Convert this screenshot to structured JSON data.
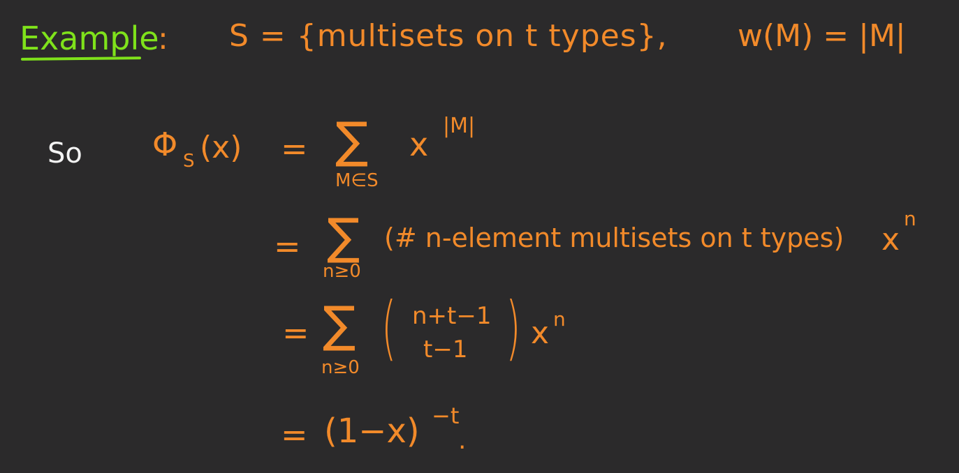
{
  "heading": {
    "label": "Example",
    "colon": ":",
    "set_definition": "S = {multisets on t types},",
    "weight_definition": "w(M) = |M|"
  },
  "derivation": {
    "intro": "So",
    "lhs": "Φ",
    "lhs_subscript": "S",
    "lhs_argument": "(x)",
    "lines": [
      {
        "equals": "=",
        "sigma": "∑",
        "range": "M∈S",
        "term": "x",
        "exponent": "|M|"
      },
      {
        "equals": "=",
        "sigma": "∑",
        "range": "n≥0",
        "term": "(# n-element multisets on t types)",
        "power_base": "x",
        "exponent": "n"
      },
      {
        "equals": "=",
        "sigma": "∑",
        "range": "n≥0",
        "binom_open": "(",
        "binom_top": "n+t−1",
        "binom_bottom": "t−1",
        "binom_close": ")",
        "power_base": "x",
        "exponent": "n"
      },
      {
        "equals": "=",
        "term": "(1−x)",
        "exponent": "−t",
        "end": "."
      }
    ]
  },
  "colors": {
    "background": "#2b2a2b",
    "ink_orange": "#f28a2a",
    "ink_white": "#f3f3f3",
    "ink_green": "#7fe21b"
  }
}
